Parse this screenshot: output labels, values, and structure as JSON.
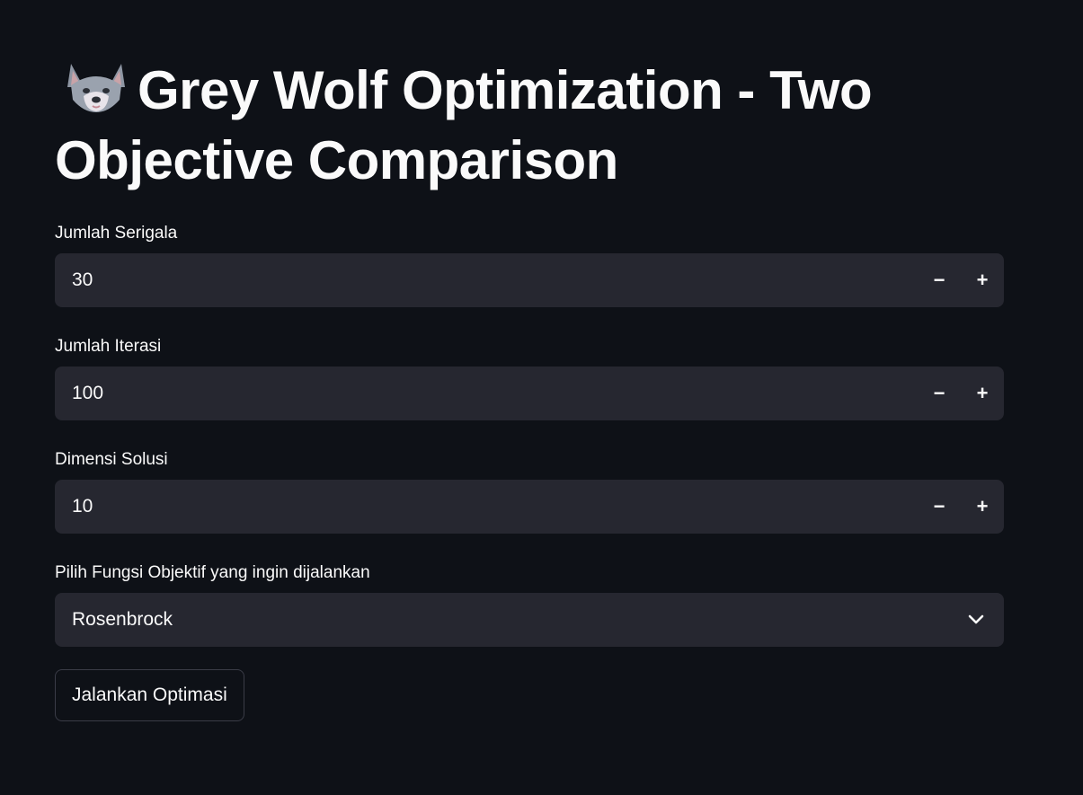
{
  "page": {
    "title_icon": "wolf-emoji-icon",
    "title": "Grey Wolf Optimization - Two Objective Comparison"
  },
  "inputs": {
    "wolves": {
      "label": "Jumlah Serigala",
      "value": "30",
      "decrement": "−",
      "increment": "+"
    },
    "iterations": {
      "label": "Jumlah Iterasi",
      "value": "100",
      "decrement": "−",
      "increment": "+"
    },
    "dimensions": {
      "label": "Dimensi Solusi",
      "value": "10",
      "decrement": "−",
      "increment": "+"
    }
  },
  "objective_select": {
    "label": "Pilih Fungsi Objektif yang ingin dijalankan",
    "selected": "Rosenbrock",
    "icon": "chevron-down-icon"
  },
  "run_button": {
    "label": "Jalankan Optimasi"
  },
  "colors": {
    "background": "#0e1117",
    "input_bg": "#262730",
    "text": "#fafafa"
  }
}
